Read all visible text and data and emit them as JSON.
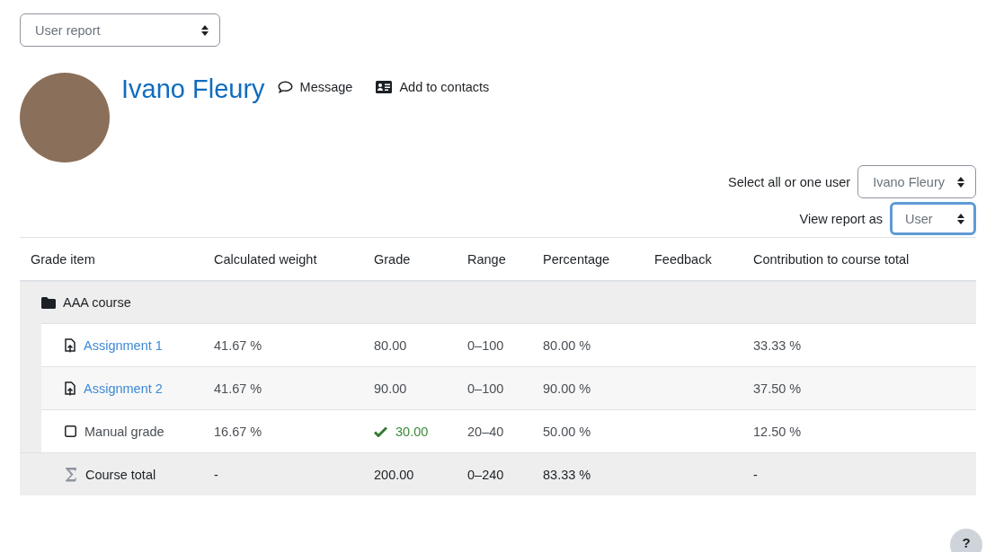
{
  "report_select": {
    "value": "User report"
  },
  "user": {
    "name": "Ivano Fleury",
    "actions": [
      {
        "kind": "message",
        "label": "Message"
      },
      {
        "kind": "contact",
        "label": "Add to contacts"
      }
    ]
  },
  "filters": [
    {
      "label": "Select all or one user",
      "value": "Ivano Fleury",
      "focused": false
    },
    {
      "label": "View report as",
      "value": "User",
      "focused": true
    }
  ],
  "table": {
    "columns": [
      "Grade item",
      "Calculated weight",
      "Grade",
      "Range",
      "Percentage",
      "Feedback",
      "Contribution to course total"
    ],
    "rows": [
      {
        "kind": "category",
        "name": "AAA course"
      },
      {
        "kind": "item",
        "link": true,
        "name": "Assignment 1",
        "weight": "41.67 %",
        "grade": "80.00",
        "passed": false,
        "range": "0–100",
        "percentage": "80.00 %",
        "contribution": "33.33 %"
      },
      {
        "kind": "item",
        "link": true,
        "name": "Assignment 2",
        "weight": "41.67 %",
        "grade": "90.00",
        "passed": false,
        "range": "0–100",
        "percentage": "90.00 %",
        "contribution": "37.50 %"
      },
      {
        "kind": "item",
        "link": false,
        "name": "Manual grade",
        "weight": "16.67 %",
        "grade": "30.00",
        "passed": true,
        "range": "20–40",
        "percentage": "50.00 %",
        "contribution": "12.50 %"
      },
      {
        "kind": "total",
        "name": "Course total",
        "weight": "-",
        "grade": "200.00",
        "range": "0–240",
        "percentage": "83.33 %",
        "contribution": "-"
      }
    ]
  },
  "help_button": {
    "label": "?"
  }
}
